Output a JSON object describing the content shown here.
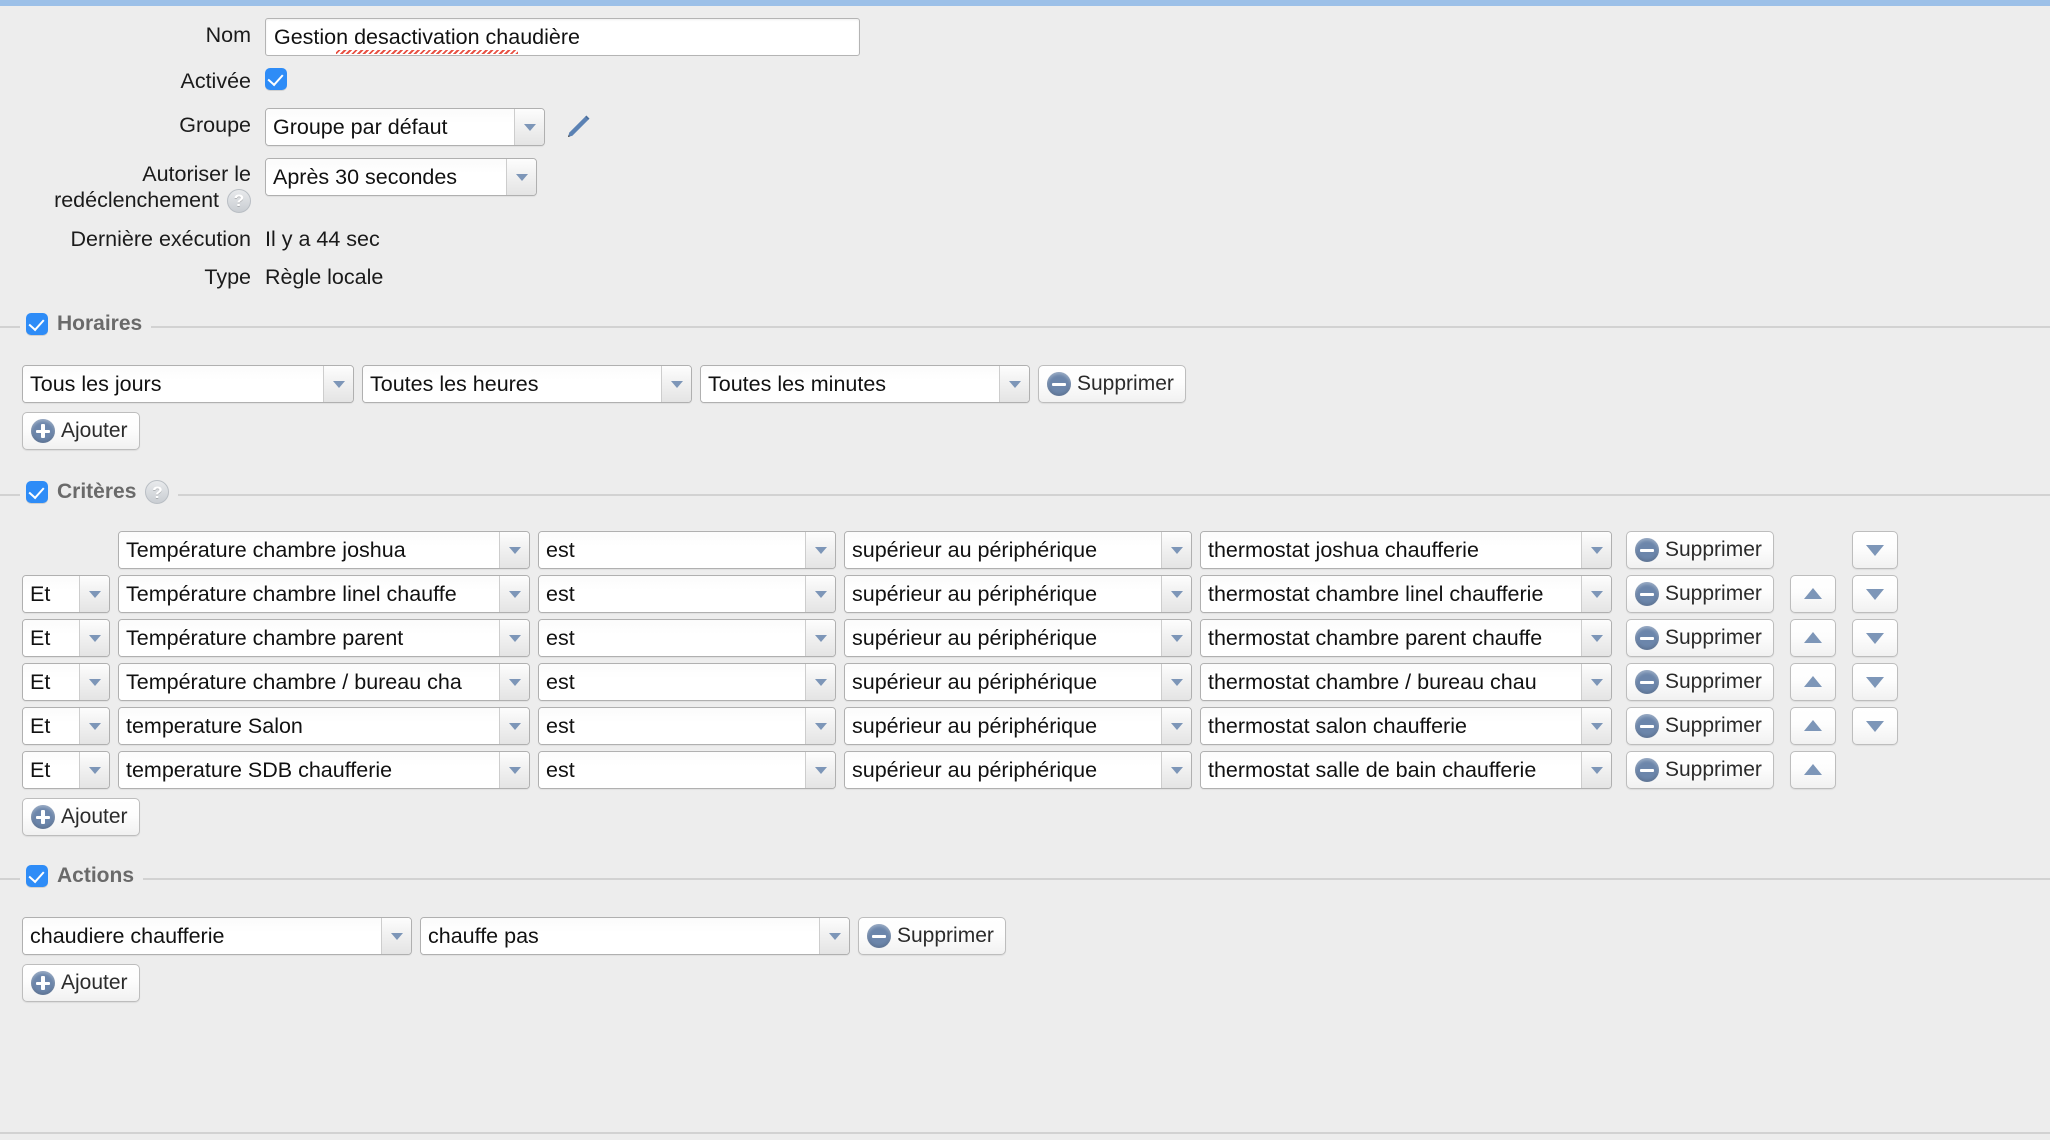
{
  "theme": {
    "accent": "#2e8cf7",
    "icon_blue": "#6c86ab",
    "arrow_blue": "#7d96b8",
    "bg": "#ededed",
    "topbar": "#9cc0e8"
  },
  "form": {
    "nom_label": "Nom",
    "nom_value": "Gestion desactivation chaudière",
    "nom_misspelled_part": "desactivation",
    "activee_label": "Activée",
    "activee_checked": true,
    "groupe_label": "Groupe",
    "groupe_value": "Groupe par défaut",
    "retrigger_label_line1": "Autoriser le",
    "retrigger_label_line2": "redéclenchement",
    "retrigger_value": "Après 30 secondes",
    "help_glyph": "?",
    "last_exec_label": "Dernière exécution",
    "last_exec_value": "Il y a 44 sec",
    "type_label": "Type",
    "type_value": "Règle locale"
  },
  "horaires": {
    "title": "Horaires",
    "checked": true,
    "rows": [
      {
        "jours": "Tous les jours",
        "heures": "Toutes les heures",
        "minutes": "Toutes les minutes",
        "delete_label": "Supprimer"
      }
    ],
    "add_label": "Ajouter"
  },
  "criteres": {
    "title": "Critères",
    "checked": true,
    "help_glyph": "?",
    "add_label": "Ajouter",
    "delete_label": "Supprimer",
    "rows": [
      {
        "logic": "",
        "device": "Température chambre joshua",
        "operator": "est",
        "comparison": "supérieur au périphérique",
        "target": "thermostat joshua chaufferie",
        "has_up": false,
        "has_down": true
      },
      {
        "logic": "Et",
        "device": "Température chambre linel chauffe",
        "operator": "est",
        "comparison": "supérieur au périphérique",
        "target": "thermostat chambre linel chaufferie",
        "has_up": true,
        "has_down": true
      },
      {
        "logic": "Et",
        "device": "Température chambre parent",
        "operator": "est",
        "comparison": "supérieur au périphérique",
        "target": "thermostat chambre parent chauffe",
        "has_up": true,
        "has_down": true
      },
      {
        "logic": "Et",
        "device": "Température chambre / bureau cha",
        "operator": "est",
        "comparison": "supérieur au périphérique",
        "target": "thermostat chambre / bureau chau",
        "has_up": true,
        "has_down": true
      },
      {
        "logic": "Et",
        "device": "temperature Salon",
        "operator": "est",
        "comparison": "supérieur au périphérique",
        "target": "thermostat salon chaufferie",
        "has_up": true,
        "has_down": true
      },
      {
        "logic": "Et",
        "device": "temperature SDB chaufferie",
        "operator": "est",
        "comparison": "supérieur au périphérique",
        "target": "thermostat salle de bain chaufferie",
        "has_up": true,
        "has_down": false
      }
    ]
  },
  "actions": {
    "title": "Actions",
    "checked": true,
    "add_label": "Ajouter",
    "rows": [
      {
        "device": "chaudiere chaufferie",
        "command": "chauffe pas",
        "delete_label": "Supprimer"
      }
    ]
  }
}
